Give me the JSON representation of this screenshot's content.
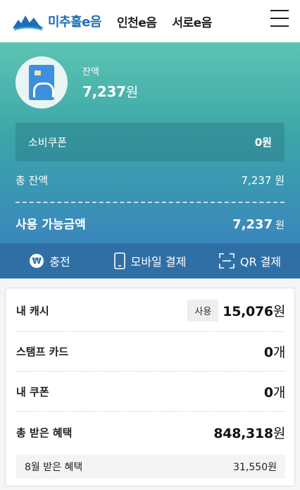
{
  "header": {
    "brand": "미추홀e음",
    "nav": [
      "인천e음",
      "서로e음"
    ],
    "menu_icon": "hamburger-icon",
    "accent_color": "#1f6db5"
  },
  "balance": {
    "label": "잔액",
    "amount": "7,237",
    "unit": "원"
  },
  "coupon": {
    "label": "소비쿠폰",
    "value": "0원"
  },
  "total": {
    "label": "총 잔액",
    "value": "7,237 원"
  },
  "available": {
    "label": "사용 가능금액",
    "amount": "7,237",
    "unit": "원"
  },
  "actions": [
    {
      "label": "충전",
      "icon": "won-icon"
    },
    {
      "label": "모바일 결제",
      "icon": "phone-icon"
    },
    {
      "label": "QR 결제",
      "icon": "qr-scan-icon"
    }
  ],
  "summary": {
    "cash": {
      "label": "내 캐시",
      "button": "사용",
      "amount": "15,076",
      "unit": "원"
    },
    "stamp": {
      "label": "스탬프 카드",
      "amount": "0",
      "unit": "개"
    },
    "coupon": {
      "label": "내 쿠폰",
      "amount": "0",
      "unit": "개"
    },
    "benefit": {
      "label": "총 받은 혜택",
      "amount": "848,318",
      "unit": "원"
    },
    "monthly": {
      "label": "8월 받은 혜택",
      "value": "31,550원"
    }
  }
}
